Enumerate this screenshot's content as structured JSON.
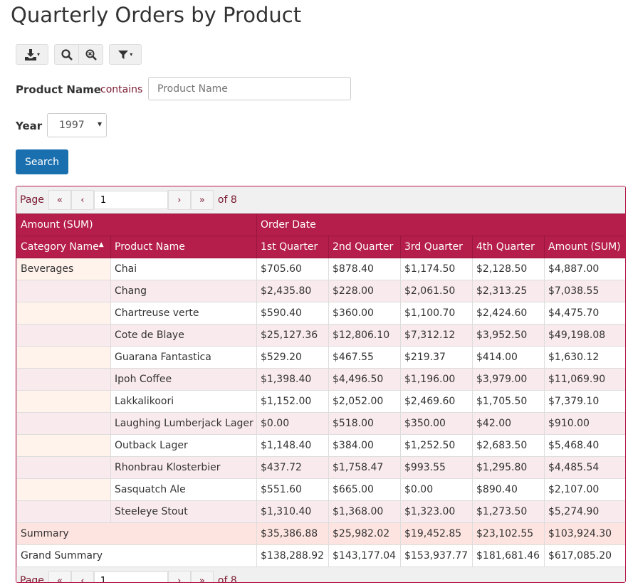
{
  "title": "Quarterly Orders by Product",
  "toolbar": {
    "export_icon": "download-icon",
    "search_icon": "search-icon",
    "zoom_icon": "zoom-reset-icon",
    "filter_icon": "filter-icon"
  },
  "filters": {
    "product_label": "Product Name",
    "product_operator": "contains",
    "product_placeholder": "Product Name",
    "year_label": "Year",
    "year_value": "1997",
    "search_label": "Search"
  },
  "pager": {
    "page_label": "Page",
    "current": "1",
    "of_label": "of 8"
  },
  "header": {
    "group_left": "Amount (SUM)",
    "group_right": "Order Date",
    "columns": [
      "Category Name",
      "Product Name",
      "1st Quarter",
      "2nd Quarter",
      "3rd Quarter",
      "4th Quarter",
      "Amount (SUM)"
    ]
  },
  "category": "Beverages",
  "rows": [
    [
      "Chai",
      "$705.60",
      "$878.40",
      "$1,174.50",
      "$2,128.50",
      "$4,887.00"
    ],
    [
      "Chang",
      "$2,435.80",
      "$228.00",
      "$2,061.50",
      "$2,313.25",
      "$7,038.55"
    ],
    [
      "Chartreuse verte",
      "$590.40",
      "$360.00",
      "$1,100.70",
      "$2,424.60",
      "$4,475.70"
    ],
    [
      "Cote de Blaye",
      "$25,127.36",
      "$12,806.10",
      "$7,312.12",
      "$3,952.50",
      "$49,198.08"
    ],
    [
      "Guarana Fantastica",
      "$529.20",
      "$467.55",
      "$219.37",
      "$414.00",
      "$1,630.12"
    ],
    [
      "Ipoh Coffee",
      "$1,398.40",
      "$4,496.50",
      "$1,196.00",
      "$3,979.00",
      "$11,069.90"
    ],
    [
      "Lakkalikoori",
      "$1,152.00",
      "$2,052.00",
      "$2,469.60",
      "$1,705.50",
      "$7,379.10"
    ],
    [
      "Laughing Lumberjack Lager",
      "$0.00",
      "$518.00",
      "$350.00",
      "$42.00",
      "$910.00"
    ],
    [
      "Outback Lager",
      "$1,148.40",
      "$384.00",
      "$1,252.50",
      "$2,683.50",
      "$5,468.40"
    ],
    [
      "Rhonbrau Klosterbier",
      "$437.72",
      "$1,758.47",
      "$993.55",
      "$1,295.80",
      "$4,485.54"
    ],
    [
      "Sasquatch Ale",
      "$551.60",
      "$665.00",
      "$0.00",
      "$890.40",
      "$2,107.00"
    ],
    [
      "Steeleye Stout",
      "$1,310.40",
      "$1,368.00",
      "$1,323.00",
      "$1,273.50",
      "$5,274.90"
    ]
  ],
  "summary": {
    "label": "Summary",
    "values": [
      "$35,386.88",
      "$25,982.02",
      "$19,452.85",
      "$23,102.55",
      "$103,924.30"
    ]
  },
  "grand": {
    "label": "Grand Summary",
    "values": [
      "$138,288.92",
      "$143,177.04",
      "$153,937.77",
      "$181,681.46",
      "$617,085.20"
    ]
  },
  "colors": {
    "header": "#b51d4a",
    "button": "#1a6fae"
  }
}
